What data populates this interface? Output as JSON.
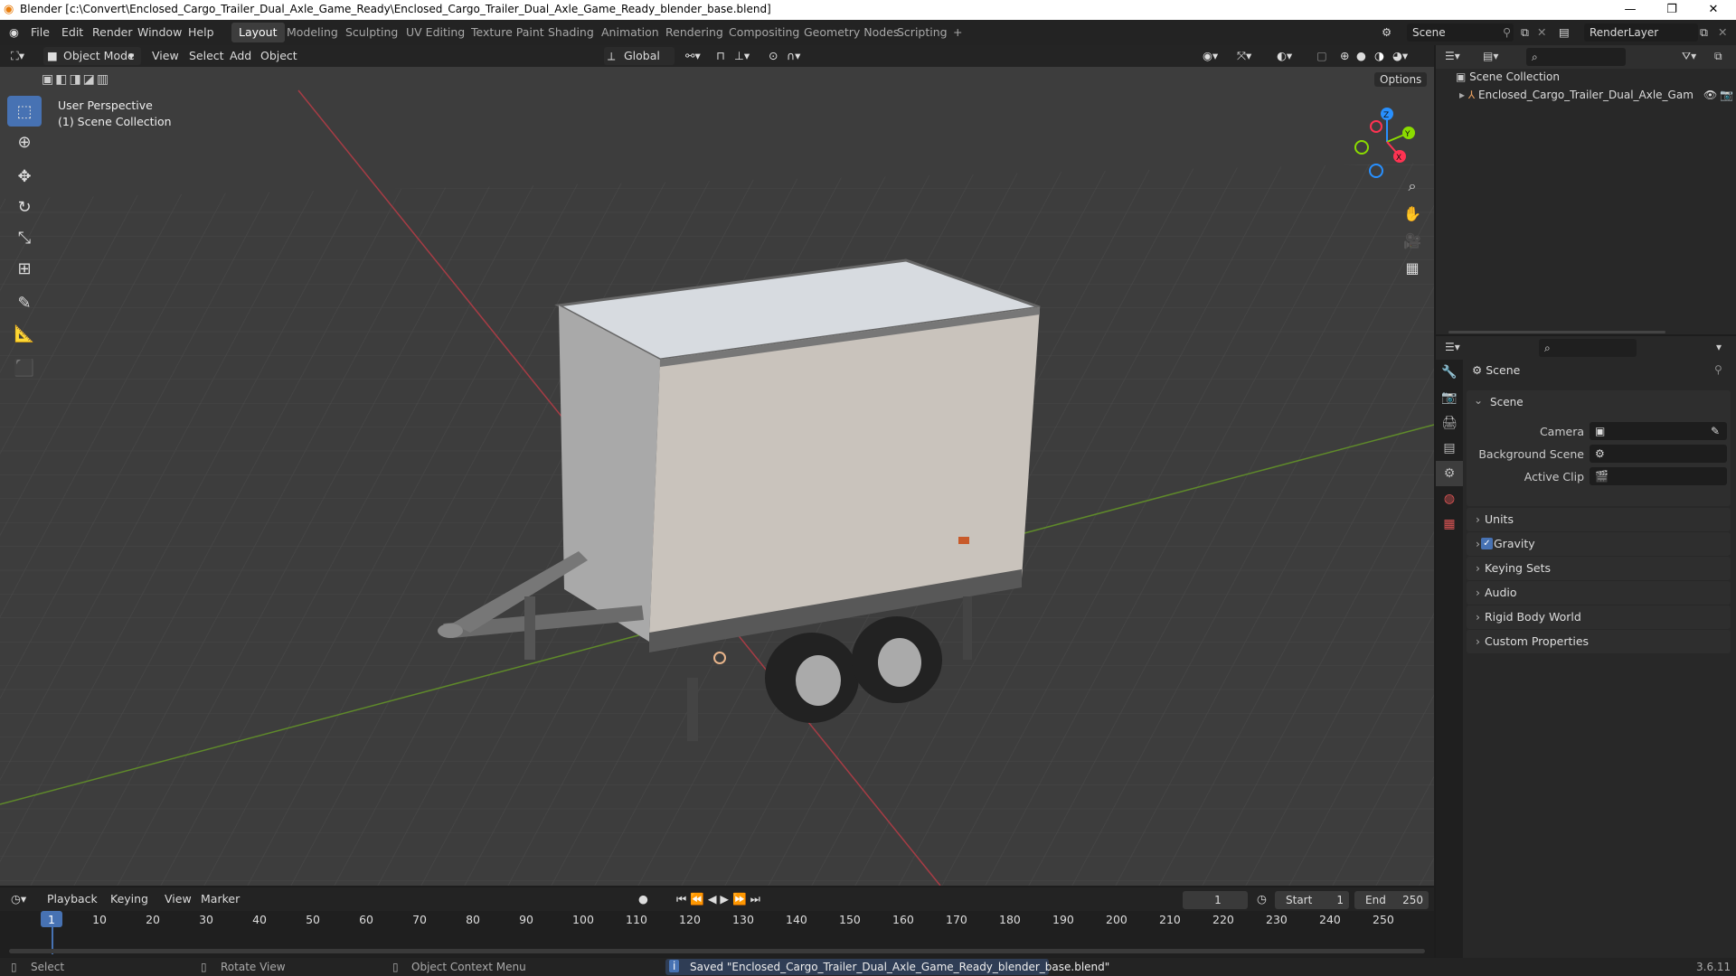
{
  "titlebar": {
    "title": "Blender [c:\\Convert\\Enclosed_Cargo_Trailer_Dual_Axle_Game_Ready\\Enclosed_Cargo_Trailer_Dual_Axle_Game_Ready_blender_base.blend]",
    "min_icon": "—",
    "max_icon": "❐",
    "close_icon": "✕"
  },
  "menu": {
    "items": [
      "File",
      "Edit",
      "Render",
      "Window",
      "Help"
    ],
    "workspaces": [
      "Layout",
      "Modeling",
      "Sculpting",
      "UV Editing",
      "Texture Paint",
      "Shading",
      "Animation",
      "Rendering",
      "Compositing",
      "Geometry Nodes",
      "Scripting",
      "+"
    ],
    "active_workspace": "Layout",
    "scene": "Scene",
    "view_layer": "RenderLayer"
  },
  "viewport_header": {
    "mode": "Object Mode",
    "menus": [
      "View",
      "Select",
      "Add",
      "Object"
    ],
    "orientation": "Global",
    "options": "Options"
  },
  "viewport": {
    "perspective": "User Perspective",
    "collection": "(1) Scene Collection",
    "gizmo": {
      "x": "X",
      "y": "Y",
      "z": "Z"
    }
  },
  "outliner": {
    "root": "Scene Collection",
    "items": [
      {
        "name": "Enclosed_Cargo_Trailer_Dual_Axle_Gam"
      }
    ]
  },
  "properties": {
    "context": "Scene",
    "panel": "Scene",
    "fields": [
      {
        "label": "Camera",
        "value": ""
      },
      {
        "label": "Background Scene",
        "value": ""
      },
      {
        "label": "Active Clip",
        "value": ""
      }
    ],
    "sections": [
      "Units",
      "Gravity",
      "Keying Sets",
      "Audio",
      "Rigid Body World",
      "Custom Properties"
    ],
    "gravity_checked": true
  },
  "timeline": {
    "menus": [
      "Playback",
      "Keying",
      "View",
      "Marker"
    ],
    "current_frame": "1",
    "start_label": "Start",
    "start": "1",
    "end_label": "End",
    "end": "250",
    "ticks": [
      "1",
      "10",
      "20",
      "30",
      "40",
      "50",
      "60",
      "70",
      "80",
      "90",
      "100",
      "110",
      "120",
      "130",
      "140",
      "150",
      "160",
      "170",
      "180",
      "190",
      "200",
      "210",
      "220",
      "230",
      "240",
      "250"
    ]
  },
  "status": {
    "select": "Select",
    "rotate": "Rotate View",
    "context_menu": "Object Context Menu",
    "message": "Saved \"Enclosed_Cargo_Trailer_Dual_Axle_Game_Ready_blender_base.blend\"",
    "version": "3.6.11"
  },
  "colors": {
    "accent": "#4772b3",
    "x_axis": "#ff3352",
    "y_axis": "#8bdc00",
    "z_axis": "#2890ff"
  }
}
